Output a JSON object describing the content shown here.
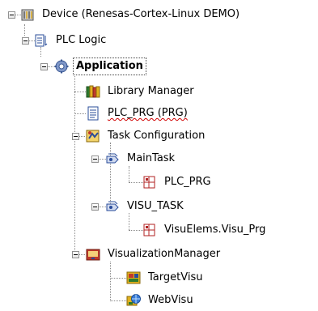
{
  "tree": {
    "device": "Device (Renesas-Cortex-Linux DEMO)",
    "plc_logic": "PLC Logic",
    "application": "Application",
    "library_manager": "Library Manager",
    "plc_prg": "PLC_PRG (PRG)",
    "task_configuration": "Task Configuration",
    "main_task": "MainTask",
    "main_task_call": "PLC_PRG",
    "visu_task": "VISU_TASK",
    "visu_task_call": "VisuElems.Visu_Prg",
    "visualization_manager": "VisualizationManager",
    "target_visu": "TargetVisu",
    "web_visu": "WebVisu"
  },
  "icons": {
    "device": "device-icon",
    "plc_logic": "plc-logic-icon",
    "application": "application-gear-icon",
    "library_manager": "library-books-icon",
    "plc_prg": "document-icon",
    "task_configuration": "task-configuration-icon",
    "task": "task-icon",
    "program_call": "program-call-icon",
    "visualization_manager": "visualization-manager-icon",
    "target_visu": "target-visu-icon",
    "web_visu": "web-visu-icon"
  }
}
